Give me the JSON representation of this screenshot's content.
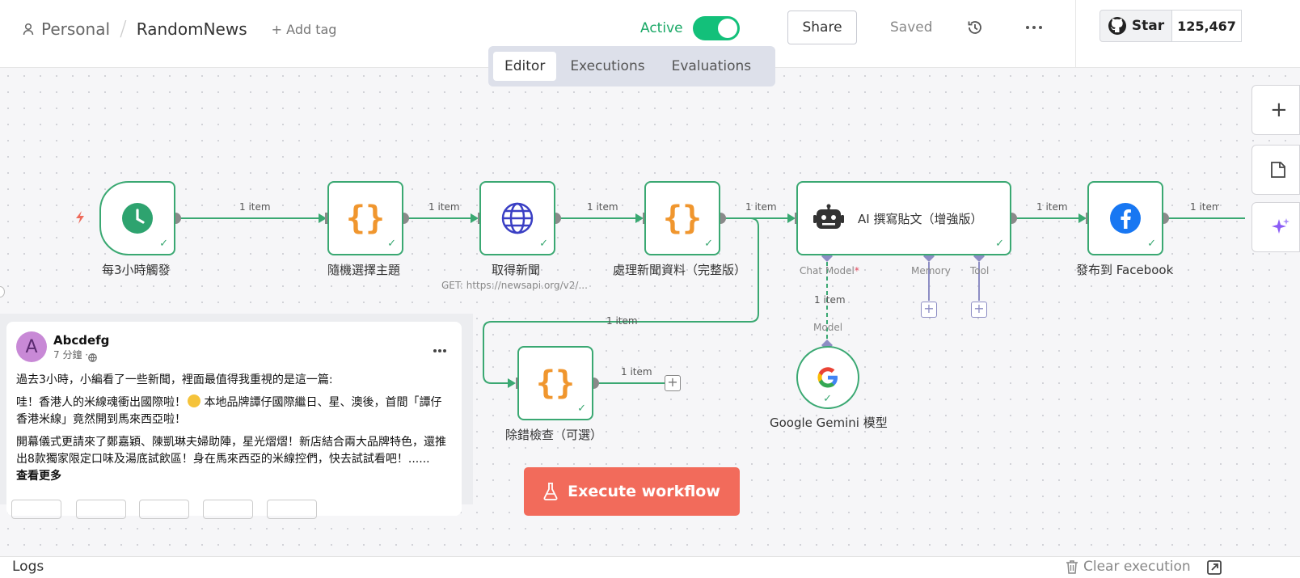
{
  "header": {
    "project": "Personal",
    "workflow_name": "RandomNews",
    "add_tag": "+ Add tag",
    "active_label": "Active",
    "share_label": "Share",
    "saved_label": "Saved",
    "star_label": "Star",
    "star_count": "125,467",
    "tabs": [
      "Editor",
      "Executions",
      "Evaluations"
    ]
  },
  "nodes": {
    "trigger": "每3小時觸發",
    "random": "隨機選擇主題",
    "fetch": "取得新聞",
    "fetch_sub": "GET: https://newsapi.org/v2/...",
    "process": "處理新聞資料（完整版）",
    "ai": "AI 撰寫貼文（增強版）",
    "facebook": "發布到 Facebook",
    "debug": "除錯檢查（可選）",
    "gemini": "Google Gemini 模型"
  },
  "connections": {
    "item_label": "1 item",
    "chat_model": "Chat Model",
    "required_mark": "*",
    "memory": "Memory",
    "tool": "Tool",
    "model": "Model"
  },
  "post": {
    "avatar_letter": "A",
    "author": "Abcdefg",
    "time": "7 分鐘 · ",
    "p1": "過去3小時，小編看了一些新聞，裡面最值得我重視的是這一篇:",
    "p2a": "哇！香港人的米線魂衝出國際啦！",
    "p2b": " 本地品牌譚仔國際繼日、星、澳後，首間「譚仔香港米線」竟然開到馬來西亞啦！",
    "p3": "開幕儀式更請來了鄭嘉穎、陳凱琳夫婦助陣，星光熠熠！新店結合兩大品牌特色，還推出8款獨家限定口味及湯底試飲區！身在馬來西亞的米線控們，快去試試看吧！......",
    "see_more": "查看更多"
  },
  "execute_label": "Execute workflow",
  "logs": {
    "title": "Logs",
    "clear": "Clear execution"
  },
  "colors": {
    "node_border": "#3aa872",
    "toggle": "#13c07a",
    "execute": "#f26b5b",
    "tab_bg": "#dde0ea",
    "sub_node": "#8d8dc4"
  },
  "icons": [
    "user-icon",
    "history-icon",
    "more-icon",
    "github-icon",
    "clock-icon",
    "braces-icon",
    "globe-icon",
    "robot-icon",
    "facebook-icon",
    "google-icon",
    "plus-icon",
    "sticky-note-icon",
    "sparkle-icon",
    "flask-icon",
    "trash-icon",
    "popout-icon",
    "bolt-icon",
    "globe-small-icon"
  ]
}
